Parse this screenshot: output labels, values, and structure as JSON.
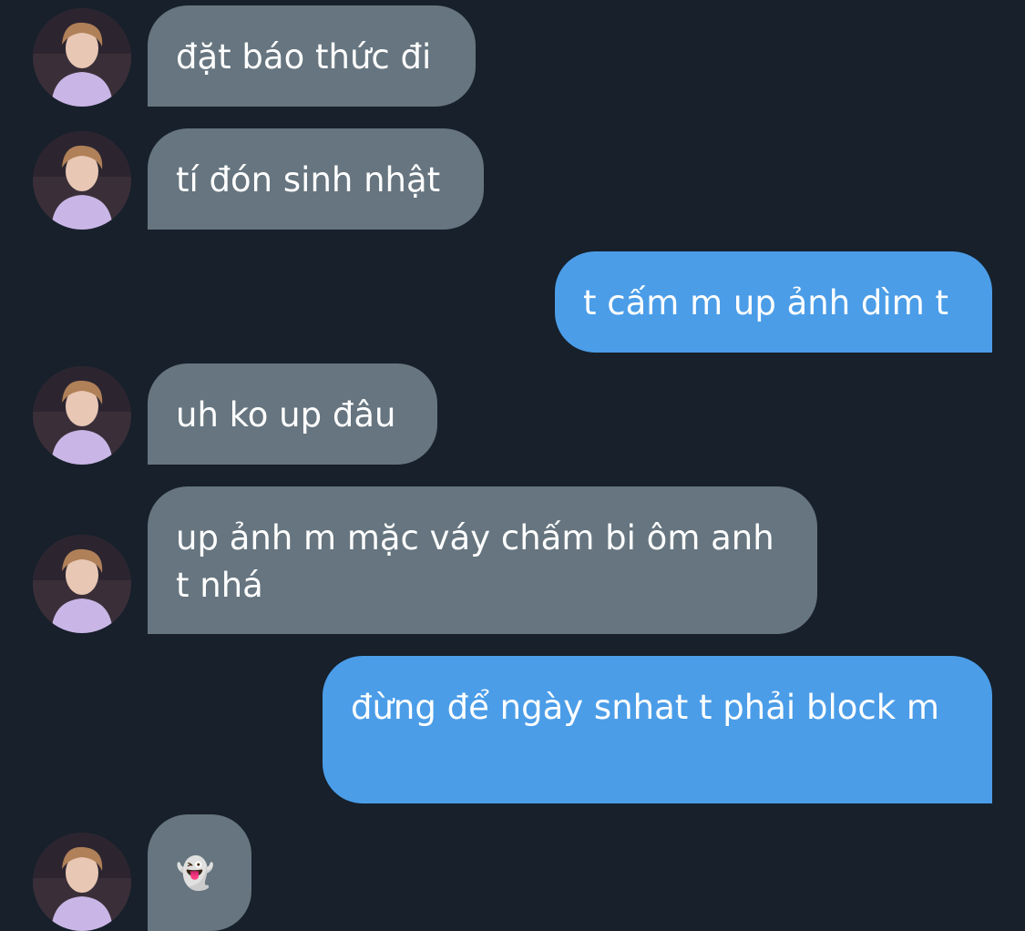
{
  "conversation": {
    "messages": [
      {
        "sender": "them",
        "text": "đặt báo thức đi"
      },
      {
        "sender": "them",
        "text": "tí đón sinh nhật"
      },
      {
        "sender": "me",
        "text": "t cấm m up ảnh dìm t"
      },
      {
        "sender": "them",
        "text": "uh ko up đâu"
      },
      {
        "sender": "them",
        "text": "up ảnh m mặc váy chấm bi ôm anh t nhá"
      },
      {
        "sender": "me",
        "text": "đừng để ngày snhat t phải block m"
      },
      {
        "sender": "them",
        "text": "👻"
      }
    ]
  },
  "colors": {
    "background": "#17202b",
    "incoming_bubble": "#66757f",
    "outgoing_bubble": "#4b9de8",
    "text": "#ffffff"
  },
  "icons": {
    "avatar": "profile-photo-avatar"
  }
}
